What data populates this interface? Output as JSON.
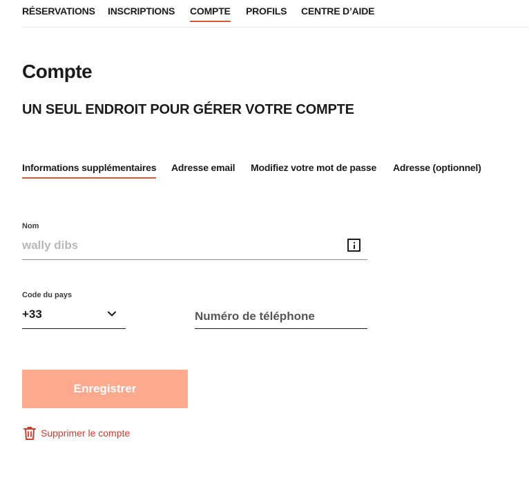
{
  "topnav": {
    "items": [
      {
        "label": "RÉSERVATIONS",
        "active": false
      },
      {
        "label": "INSCRIPTIONS",
        "active": false
      },
      {
        "label": "COMPTE",
        "active": true
      },
      {
        "label": "PROFILS",
        "active": false
      },
      {
        "label": "CENTRE D’AIDE",
        "active": false
      }
    ]
  },
  "page": {
    "title": "Compte",
    "subtitle": "UN SEUL ENDROIT POUR GÉRER VOTRE COMPTE"
  },
  "subtabs": [
    {
      "label": "Informations supplémentaires",
      "active": true
    },
    {
      "label": "Adresse email",
      "active": false
    },
    {
      "label": "Modifiez votre mot de passe",
      "active": false
    },
    {
      "label": "Adresse (optionnel)",
      "active": false
    }
  ],
  "form": {
    "name": {
      "label": "Nom",
      "value": "wally dibs",
      "icon": "info-icon"
    },
    "country": {
      "label": "Code du pays",
      "value": "+33",
      "icon": "chevron-down-icon"
    },
    "phone": {
      "placeholder": "Numéro de téléphone",
      "value": ""
    },
    "save_label": "Enregistrer",
    "delete_label": "Supprimer le compte",
    "delete_icon": "trash-icon"
  },
  "colors": {
    "accent": "#e8532f",
    "button_bg": "#fda98e",
    "danger": "#d23a2a"
  }
}
